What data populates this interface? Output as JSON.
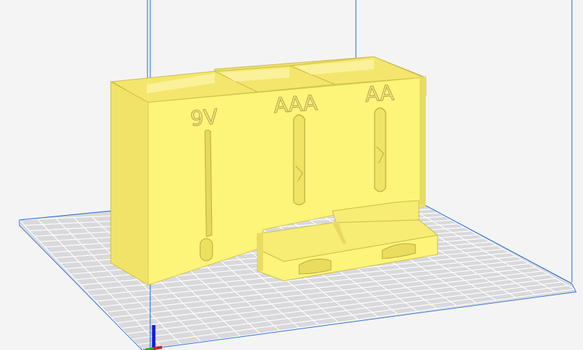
{
  "viewport": {
    "background_color": "#f4f4f5",
    "build_plate": {
      "fill_color": "#d9d9dc",
      "grid_color": "#ffffff",
      "edge_color": "#c9c9cc",
      "boundary_color": "#1565e0"
    },
    "model": {
      "color": "#fdf47a",
      "labels": {
        "left": "9V",
        "middle": "AAA",
        "right": "AA"
      }
    },
    "axis": {
      "z_color": "#1a1acc",
      "x_color": "#cc2020",
      "y_color": "#20aa20"
    }
  }
}
